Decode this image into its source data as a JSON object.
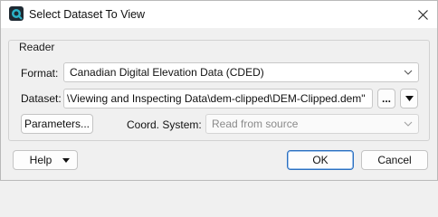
{
  "window": {
    "title": "Select Dataset To View"
  },
  "icons": {
    "app": "fme-app-icon",
    "close": "close-icon",
    "chevron": "chevron-down-icon",
    "dropdown": "triangle-down-icon"
  },
  "reader": {
    "group_label": "Reader",
    "format_label": "Format:",
    "format_value": "Canadian Digital Elevation Data (CDED)",
    "dataset_label": "Dataset:",
    "dataset_value": "\\Viewing and Inspecting Data\\dem-clipped\\DEM-Clipped.dem\"",
    "browse_label": "...",
    "parameters_label": "Parameters...",
    "coord_label": "Coord. System:",
    "coord_value": "Read from source"
  },
  "footer": {
    "help_label": "Help",
    "ok_label": "OK",
    "cancel_label": "Cancel"
  },
  "colors": {
    "accent": "#2a6fc0",
    "background": "#f0f0f0"
  }
}
